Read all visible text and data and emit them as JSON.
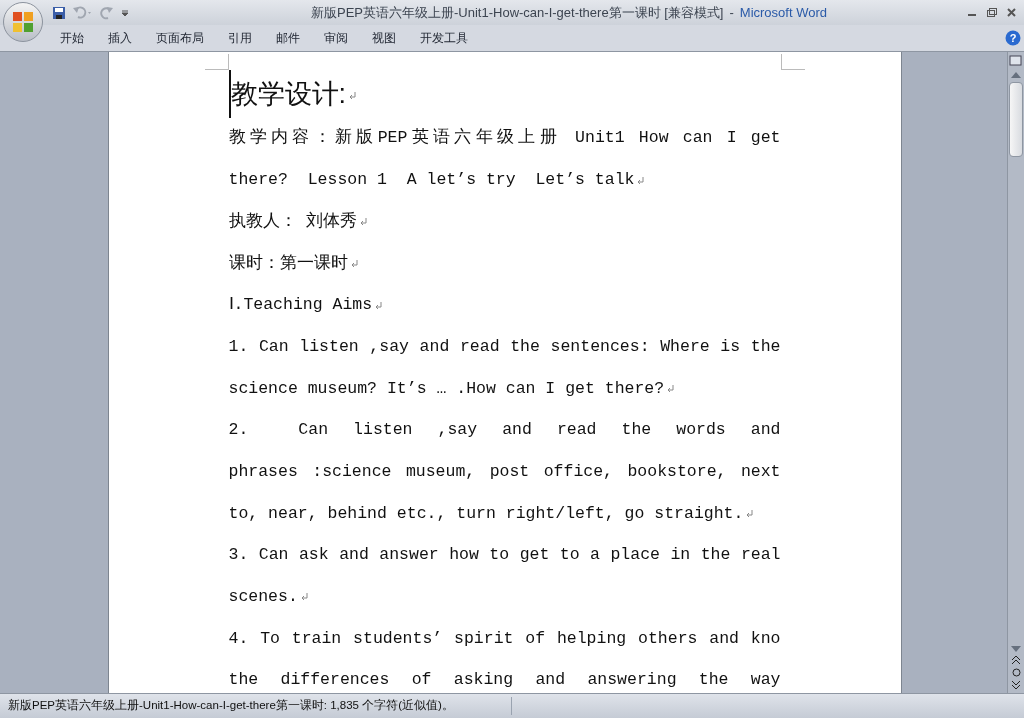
{
  "window": {
    "title": "新版PEP英语六年级上册-Unit1-How-can-I-get-there第一课时 [兼容模式]",
    "separator": "-",
    "app_name": "Microsoft Word",
    "help": "?"
  },
  "ribbon_tabs": [
    {
      "label": "开始",
      "selected": false
    },
    {
      "label": "插入",
      "selected": false
    },
    {
      "label": "页面布局",
      "selected": false
    },
    {
      "label": "引用",
      "selected": false
    },
    {
      "label": "邮件",
      "selected": false
    },
    {
      "label": "审阅",
      "selected": false
    },
    {
      "label": "视图",
      "selected": false
    },
    {
      "label": "开发工具",
      "selected": false
    }
  ],
  "document": {
    "heading": {
      "text": "教学设计:",
      "mark": true
    },
    "lines": [
      {
        "text": "教学内容：新版PEP英语六年级上册 Unit1 How can I get",
        "kind": "full",
        "mark": false
      },
      {
        "text": "there?  Lesson 1  A let’s try  Let’s talk",
        "kind": "end",
        "mark": true
      },
      {
        "text": "执教人： 刘体秀",
        "kind": "end",
        "mark": true
      },
      {
        "text": "课时：第一课时",
        "kind": "end",
        "mark": true
      },
      {
        "text": "Ⅰ.Teaching Aims",
        "kind": "end",
        "mark": true
      },
      {
        "text": "1. Can listen ,say and read the sentences: Where is the",
        "kind": "full",
        "mark": false
      },
      {
        "text": "science museum? It’s … .How can I get there?",
        "kind": "end",
        "mark": true
      },
      {
        "text": "2.  Can listen ,say and read the words and",
        "kind": "full",
        "mark": false
      },
      {
        "text": "phrases :science museum, post office, bookstore, next",
        "kind": "full",
        "mark": false
      },
      {
        "text": "to, near, behind etc., turn right/left, go straight.",
        "kind": "end",
        "mark": true
      },
      {
        "text": "3. Can ask and answer how to get to a place in the real",
        "kind": "full",
        "mark": false
      },
      {
        "text": "scenes.",
        "kind": "end",
        "mark": true
      },
      {
        "text": "4. To train students’ spirit of helping others and kno",
        "kind": "full",
        "mark": false
      },
      {
        "text": "the differences of asking and answering the way",
        "kind": "full",
        "mark": false
      }
    ]
  },
  "status_bar": {
    "text": "新版PEP英语六年级上册-Unit1-How-can-I-get-there第一课时: 1,835 个字符(近似值)。"
  }
}
